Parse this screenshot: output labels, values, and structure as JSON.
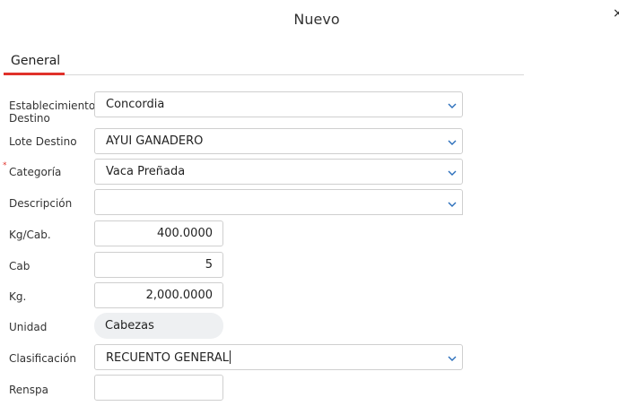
{
  "dialog": {
    "title": "Nuevo",
    "close_label": "×"
  },
  "tabs": [
    {
      "label": "General",
      "active": true
    }
  ],
  "accent_color": "#e0312a",
  "form": {
    "establecimiento": {
      "label": "Establecimiento Destino",
      "value": "Concordia"
    },
    "lote": {
      "label": "Lote Destino",
      "value": "AYUI GANADERO"
    },
    "categoria": {
      "label": "Categoría",
      "value": "Vaca Preñada",
      "required_mark": "*"
    },
    "descripcion": {
      "label": "Descripción",
      "value": ""
    },
    "kg_cab": {
      "label": "Kg/Cab.",
      "value": "400.0000"
    },
    "cab": {
      "label": "Cab",
      "value": "5"
    },
    "kg": {
      "label": "Kg.",
      "value": "2,000.0000"
    },
    "unidad": {
      "label": "Unidad",
      "value": "Cabezas"
    },
    "clasificacion": {
      "label": "Clasificación",
      "value": "RECUENTO GENERAL"
    },
    "renspa": {
      "label": "Renspa",
      "value": ""
    }
  }
}
